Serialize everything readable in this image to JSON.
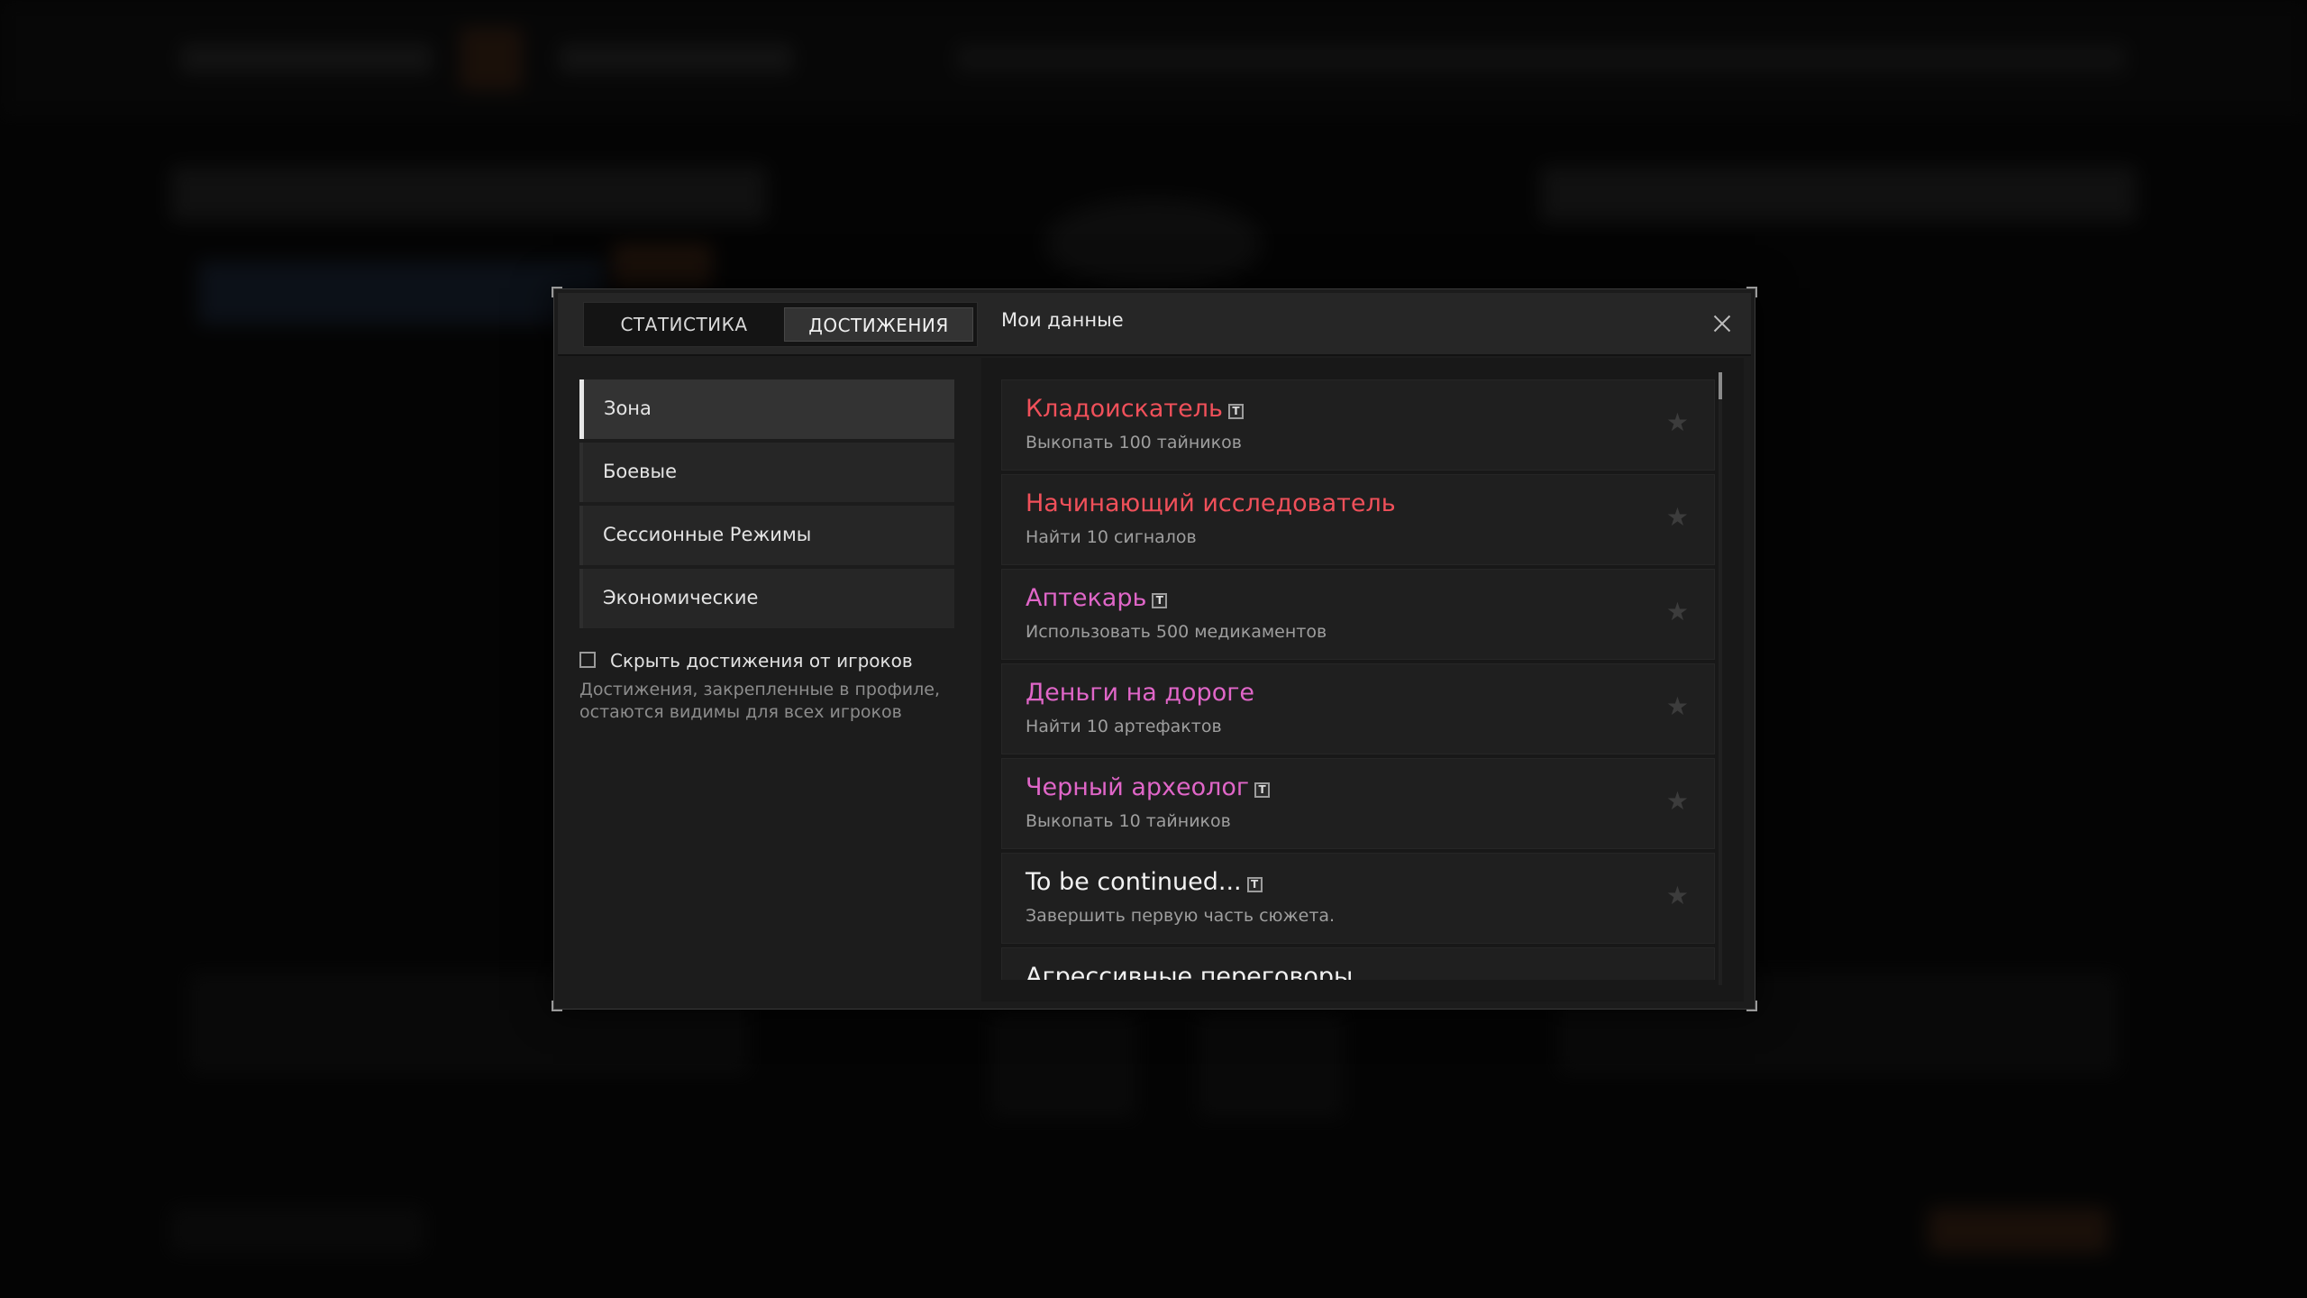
{
  "dialog": {
    "tabs": [
      "СТАТИСТИКА",
      "ДОСТИЖЕНИЯ"
    ],
    "active_tab": "ДОСТИЖЕНИЯ",
    "title": "Мои данные",
    "close_icon": "close-icon"
  },
  "categories": [
    {
      "label": "Зона",
      "active": true
    },
    {
      "label": "Боевые",
      "active": false
    },
    {
      "label": "Сессионные Режимы",
      "active": false
    },
    {
      "label": "Экономические",
      "active": false
    }
  ],
  "hide_option": {
    "label": "Скрыть достижения от игроков",
    "checked": false,
    "hint": "Достижения, закрепленные в профиле, остаются видимы для всех игроков"
  },
  "achievements": [
    {
      "title": "Кладоискатель",
      "description": "Выкопать 100 тайников",
      "color": "#f0505a",
      "has_t_icon": true,
      "t_icon_label": "T"
    },
    {
      "title": "Начинающий исследователь",
      "description": "Найти 10 сигналов",
      "color": "#f0505a",
      "has_t_icon": false
    },
    {
      "title": "Аптекарь",
      "description": "Использовать 500 медикаментов",
      "color": "#e066c8",
      "has_t_icon": true,
      "t_icon_label": "T"
    },
    {
      "title": "Деньги на дороге",
      "description": "Найти 10 артефактов",
      "color": "#e066c8",
      "has_t_icon": false
    },
    {
      "title": "Черный археолог",
      "description": "Выкопать 10 тайников",
      "color": "#e066c8",
      "has_t_icon": true,
      "t_icon_label": "T"
    },
    {
      "title": "To be continued...",
      "description": "Завершить первую часть сюжета.",
      "color": "#f2f2f2",
      "has_t_icon": true,
      "t_icon_label": "T"
    },
    {
      "title": "Агрессивные переговоры",
      "description": "",
      "color": "#f2f2f2",
      "has_t_icon": false
    }
  ],
  "icons": {
    "star": "star-icon",
    "t": "t-badge-icon"
  }
}
